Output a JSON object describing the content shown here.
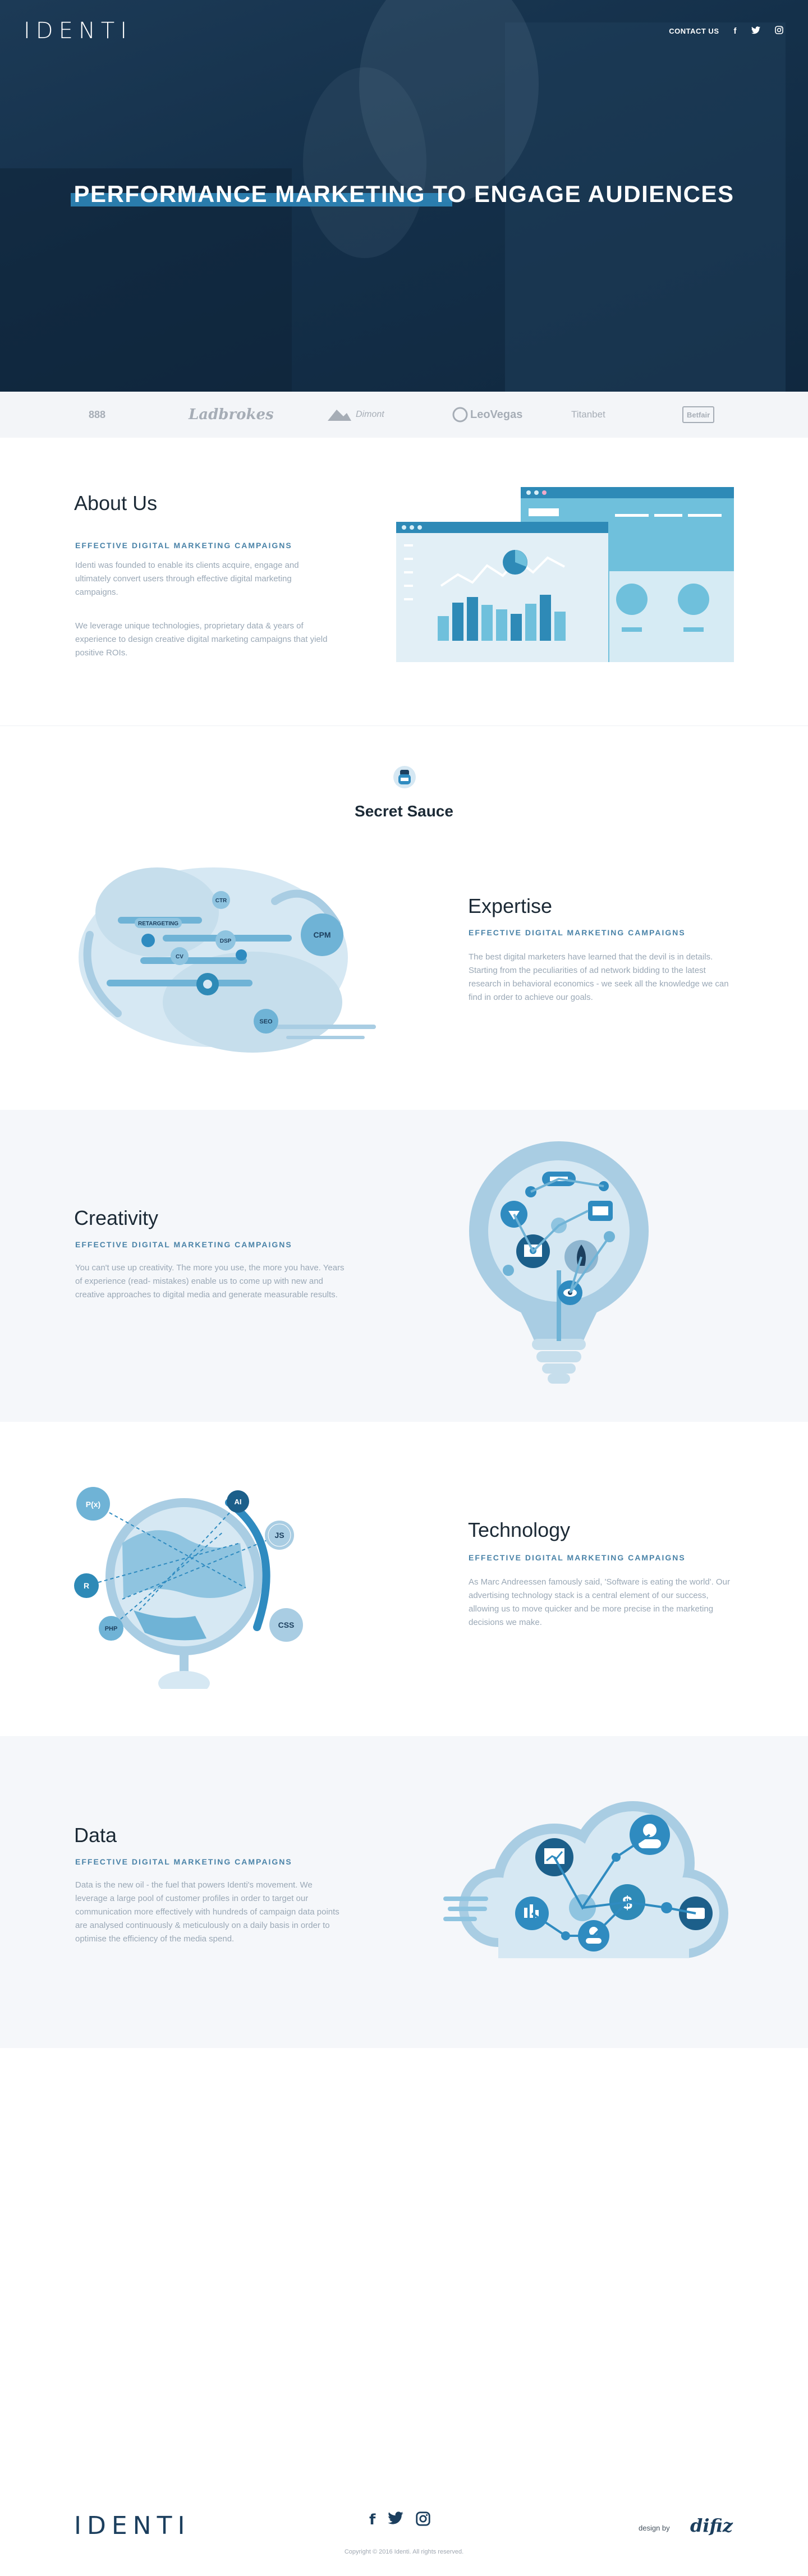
{
  "header": {
    "logo": "IDENTI",
    "nav": {
      "contact": "CONTACT US"
    },
    "social": [
      {
        "icon": "facebook-icon",
        "glyph": "f"
      },
      {
        "icon": "twitter-icon",
        "glyph": "🐦"
      },
      {
        "icon": "instagram-icon",
        "glyph": "◎"
      }
    ]
  },
  "hero": {
    "title_part1": "PERFORMANCE MARKETING",
    "title_part2": " TO ENGAGE AUDIENCES"
  },
  "brands": [
    "888",
    "Ladbrokes",
    "Dimont",
    "LeoVegas",
    "Titanbet",
    "Betfair"
  ],
  "about": {
    "title": "About Us",
    "subtitle": "EFFECTIVE DIGITAL MARKETING CAMPAIGNS",
    "p1": "Identi was founded to enable its clients acquire, engage and ultimately convert users through effective digital marketing campaigns.",
    "p2": "We leverage unique technologies, proprietary data & years of experience to design creative digital marketing campaigns that yield positive ROIs."
  },
  "sauce": {
    "title": "Secret Sauce"
  },
  "expertise": {
    "title": "Expertise",
    "subtitle": "EFFECTIVE DIGITAL MARKETING CAMPAIGNS",
    "body": "The best digital marketers have learned that the devil is in details. Starting from the peculiarities of ad network bidding to the latest research in behavioral economics - we seek all the knowledge we can find in order to achieve our goals.",
    "labels": {
      "ctr": "CTR",
      "retargeting": "RETARGETING",
      "dsp": "DSP",
      "cv": "CV",
      "cpm": "CPM",
      "seo": "SEO"
    }
  },
  "creativity": {
    "title": "Creativity",
    "subtitle": "EFFECTIVE DIGITAL MARKETING CAMPAIGNS",
    "body": "You can't use up creativity. The more you use, the more you have. Years of experience (read- mistakes) enable us to come up with new and creative approaches to digital media and generate measurable results."
  },
  "technology": {
    "title": "Technology",
    "subtitle": "EFFECTIVE DIGITAL MARKETING CAMPAIGNS",
    "body": "As Marc Andreessen famously said, 'Software is eating the world'. Our advertising technology stack is a central element of our success, allowing us to move quicker and be more precise in the marketing decisions we make.",
    "labels": {
      "px": "P(x)",
      "ai": "AI",
      "js": "JS",
      "r": "R",
      "php": "PHP",
      "css": "CSS"
    }
  },
  "data": {
    "title": "Data",
    "subtitle": "EFFECTIVE DIGITAL MARKETING CAMPAIGNS",
    "body": "Data is the new oil - the fuel that powers Identi's movement. We leverage a large pool of customer profiles in order to target our communication more effectively with hundreds of campaign data points are analysed continuously & meticulously on a daily basis in order to optimise the efficiency of the media spend."
  },
  "footer": {
    "logo": "IDENTI",
    "copyright": "Copyright © 2016 Identi. All rights reserved.",
    "design_by": "design by",
    "designer": "difiz"
  },
  "colors": {
    "brand_dark": "#1c3f5e",
    "accent": "#2f8bc0",
    "light_blue": "#a9cde3",
    "pale_blue": "#d6e8f3"
  }
}
